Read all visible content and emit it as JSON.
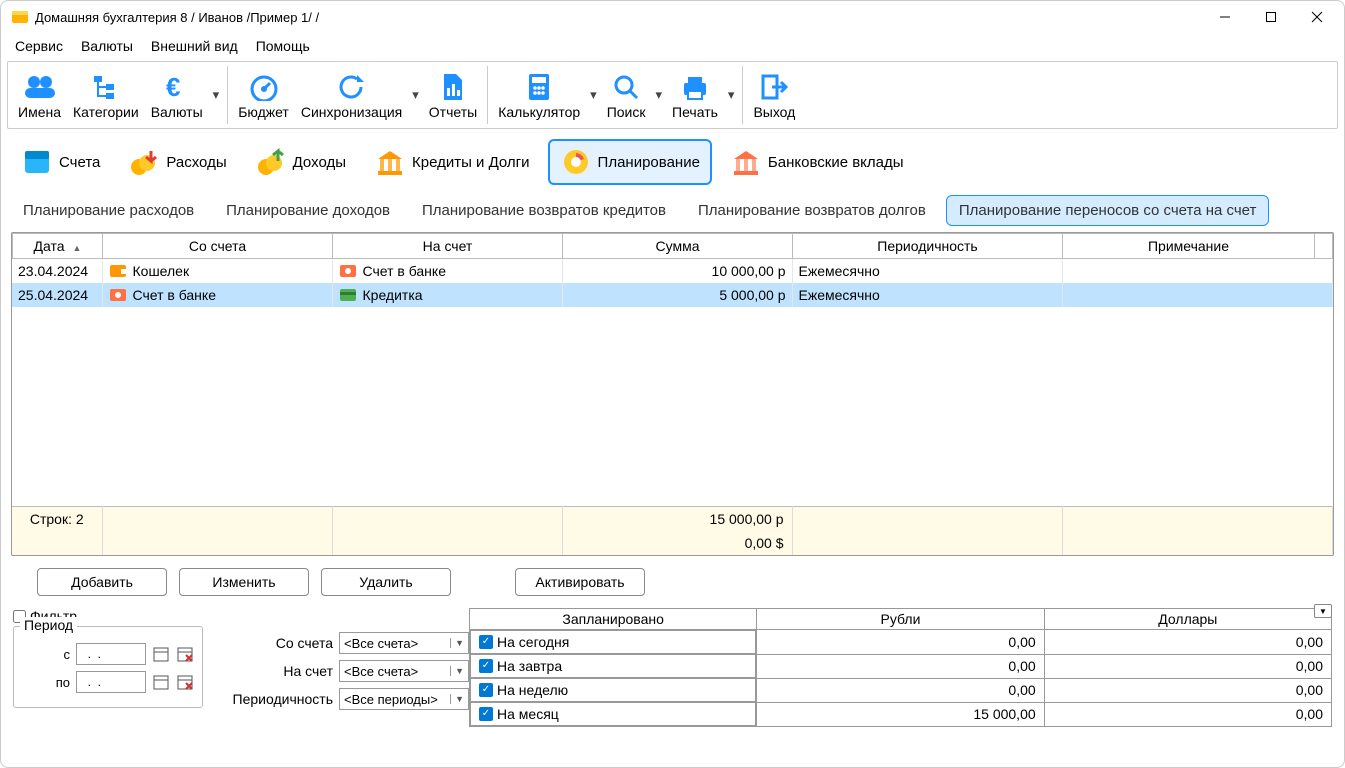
{
  "title": "Домашняя бухгалтерия 8  / Иванов /Пример 1/ /",
  "menu": [
    "Сервис",
    "Валюты",
    "Внешний вид",
    "Помощь"
  ],
  "toolbar": {
    "names": "Имена",
    "categories": "Категории",
    "currencies": "Валюты",
    "budget": "Бюджет",
    "sync": "Синхронизация",
    "reports": "Отчеты",
    "calculator": "Калькулятор",
    "search": "Поиск",
    "print": "Печать",
    "exit": "Выход"
  },
  "sections": {
    "accounts": "Счета",
    "expenses": "Расходы",
    "income": "Доходы",
    "credits": "Кредиты и Долги",
    "planning": "Планирование",
    "deposits": "Банковские вклады"
  },
  "subtabs": {
    "plan_expenses": "Планирование расходов",
    "plan_income": "Планирование доходов",
    "plan_credit_return": "Планирование возвратов кредитов",
    "plan_debt_return": "Планирование возвратов долгов",
    "plan_transfers": "Планирование переносов со счета на счет"
  },
  "table": {
    "headers": {
      "date": "Дата",
      "from": "Со счета",
      "to": "На счет",
      "sum": "Сумма",
      "period": "Периодичность",
      "note": "Примечание"
    },
    "rows": [
      {
        "date": "23.04.2024",
        "from": "Кошелек",
        "to": "Счет в банке",
        "sum": "10 000,00 р",
        "period": "Ежемесячно",
        "note": ""
      },
      {
        "date": "25.04.2024",
        "from": "Счет в банке",
        "to": "Кредитка",
        "sum": "5 000,00 р",
        "period": "Ежемесячно",
        "note": ""
      }
    ],
    "footer_rows_label": "Строк: 2",
    "footer_sum_rub": "15 000,00 р",
    "footer_sum_usd": "0,00 $"
  },
  "actions": {
    "add": "Добавить",
    "edit": "Изменить",
    "delete": "Удалить",
    "activate": "Активировать"
  },
  "filter": {
    "checkbox": "Фильтр",
    "period_legend": "Период",
    "from_label": "с",
    "to_label": "по",
    "date_placeholder": "  .  .",
    "from_account": {
      "label": "Со счета",
      "value": "<Все счета>"
    },
    "to_account": {
      "label": "На счет",
      "value": "<Все счета>"
    },
    "periodicity": {
      "label": "Периодичность",
      "value": "<Все периоды>"
    }
  },
  "summary": {
    "h1": "Запланировано",
    "h2": "Рубли",
    "h3": "Доллары",
    "rows": [
      {
        "label": "На сегодня",
        "rub": "0,00",
        "usd": "0,00"
      },
      {
        "label": "На завтра",
        "rub": "0,00",
        "usd": "0,00"
      },
      {
        "label": "На неделю",
        "rub": "0,00",
        "usd": "0,00"
      },
      {
        "label": "На месяц",
        "rub": "15 000,00",
        "usd": "0,00"
      }
    ]
  }
}
